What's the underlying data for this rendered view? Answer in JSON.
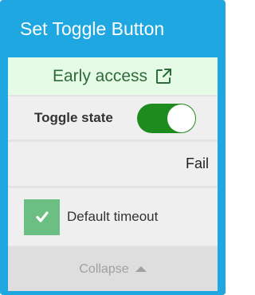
{
  "node": {
    "title": "Set Toggle Button"
  },
  "early_access": {
    "label": "Early access",
    "icon": "external-link-icon"
  },
  "toggle": {
    "label": "Toggle state",
    "on": true,
    "on_color": "#1e8b1e"
  },
  "result": {
    "text": "Fail"
  },
  "timeout": {
    "label": "Default timeout",
    "checked": true,
    "check_color": "#6bbf82",
    "icon": "check-icon"
  },
  "footer": {
    "collapse_label": "Collapse",
    "icon": "caret-up-icon"
  },
  "colors": {
    "header": "#1ea7e1",
    "early_access_bg": "#e6fbe6",
    "early_access_text": "#2e6b3a"
  }
}
